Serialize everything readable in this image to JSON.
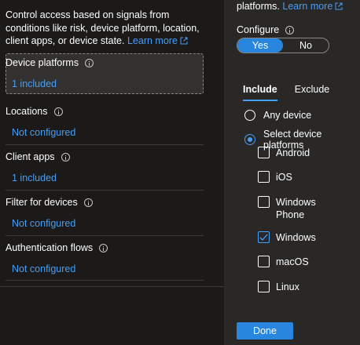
{
  "left": {
    "intro": {
      "text": "Control access based on signals from conditions like risk, device platform, location, client apps, or device state.",
      "learn_more": "Learn more"
    },
    "sections": [
      {
        "title": "Device platforms",
        "value": "1 included"
      },
      {
        "title": "Locations",
        "value": "Not configured"
      },
      {
        "title": "Client apps",
        "value": "1 included"
      },
      {
        "title": "Filter for devices",
        "value": "Not configured"
      },
      {
        "title": "Authentication flows",
        "value": "Not configured"
      }
    ]
  },
  "right": {
    "top_text": "platforms.",
    "top_learn_more": "Learn more",
    "configure_label": "Configure",
    "toggle": {
      "yes": "Yes",
      "no": "No",
      "selected": "Yes"
    },
    "tabs": [
      "Include",
      "Exclude"
    ],
    "active_tab": "Include",
    "radios": [
      {
        "label": "Any device",
        "checked": false
      },
      {
        "label": "Select device platforms",
        "checked": true
      }
    ],
    "platforms": [
      {
        "label": "Android",
        "checked": false
      },
      {
        "label": "iOS",
        "checked": false
      },
      {
        "label": "Windows Phone",
        "checked": false
      },
      {
        "label": "Windows",
        "checked": true
      },
      {
        "label": "macOS",
        "checked": false
      },
      {
        "label": "Linux",
        "checked": false
      }
    ],
    "done_label": "Done"
  },
  "colors": {
    "accent": "#479ef5",
    "button": "#2886de",
    "panel": "#292827",
    "background": "#1b1a19"
  }
}
